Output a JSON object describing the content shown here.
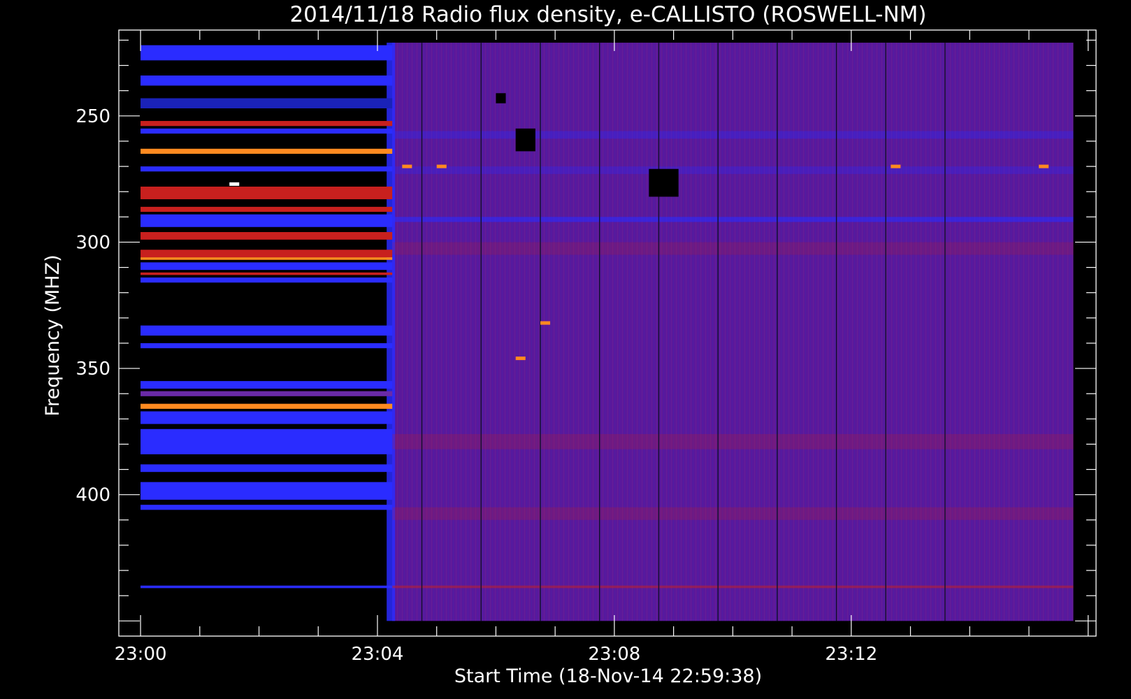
{
  "chart_data": {
    "type": "heatmap",
    "title": "2014/11/18  Radio flux density, e-CALLISTO (ROSWELL-NM)",
    "xlabel": "Start Time (18-Nov-14 22:59:38)",
    "ylabel": "Frequency (MHZ)",
    "x_unit": "HH:MM",
    "xlim": [
      "22:59:38",
      "23:16:08"
    ],
    "ylim": [
      456,
      216
    ],
    "y_inverted": true,
    "x_ticks": [
      {
        "value": "23:00",
        "label": "23:00"
      },
      {
        "value": "23:04",
        "label": "23:04"
      },
      {
        "value": "23:08",
        "label": "23:08"
      },
      {
        "value": "23:12",
        "label": "23:12"
      }
    ],
    "y_ticks": [
      {
        "value": 250,
        "label": "250"
      },
      {
        "value": 300,
        "label": "300"
      },
      {
        "value": 350,
        "label": "350"
      },
      {
        "value": 400,
        "label": "400"
      }
    ],
    "data_extent": {
      "time_start": "23:00:00",
      "time_end": "23:15:45",
      "freq_min": 221,
      "freq_max": 450
    },
    "transition_time": "23:04:15",
    "vertical_lines_time": [
      "23:04:45",
      "23:05:45",
      "23:06:45",
      "23:07:45",
      "23:08:45",
      "23:09:45",
      "23:10:45",
      "23:11:45",
      "23:12:35",
      "23:13:35"
    ],
    "pre_transition_bands": [
      {
        "freq_start": 222,
        "freq_end": 228,
        "level": "blue"
      },
      {
        "freq_start": 234,
        "freq_end": 238,
        "level": "blue"
      },
      {
        "freq_start": 243,
        "freq_end": 247,
        "level": "darkblue"
      },
      {
        "freq_start": 252,
        "freq_end": 254,
        "level": "red"
      },
      {
        "freq_start": 255,
        "freq_end": 257,
        "level": "blue"
      },
      {
        "freq_start": 263,
        "freq_end": 265,
        "level": "orange"
      },
      {
        "freq_start": 270,
        "freq_end": 272,
        "level": "blue"
      },
      {
        "freq_start": 278,
        "freq_end": 283,
        "level": "red"
      },
      {
        "freq_start": 286,
        "freq_end": 288,
        "level": "red"
      },
      {
        "freq_start": 289,
        "freq_end": 294,
        "level": "blue"
      },
      {
        "freq_start": 296,
        "freq_end": 299,
        "level": "red"
      },
      {
        "freq_start": 303,
        "freq_end": 306,
        "level": "red"
      },
      {
        "freq_start": 306,
        "freq_end": 307,
        "level": "orange"
      },
      {
        "freq_start": 308,
        "freq_end": 311,
        "level": "blue"
      },
      {
        "freq_start": 312,
        "freq_end": 313,
        "level": "red"
      },
      {
        "freq_start": 314,
        "freq_end": 316,
        "level": "blue"
      },
      {
        "freq_start": 333,
        "freq_end": 337,
        "level": "blue"
      },
      {
        "freq_start": 340,
        "freq_end": 342,
        "level": "blue"
      },
      {
        "freq_start": 355,
        "freq_end": 358,
        "level": "blue"
      },
      {
        "freq_start": 359,
        "freq_end": 361,
        "level": "purple"
      },
      {
        "freq_start": 364,
        "freq_end": 366,
        "level": "orange"
      },
      {
        "freq_start": 367,
        "freq_end": 372,
        "level": "blue"
      },
      {
        "freq_start": 374,
        "freq_end": 384,
        "level": "blue"
      },
      {
        "freq_start": 388,
        "freq_end": 391,
        "level": "blue"
      },
      {
        "freq_start": 395,
        "freq_end": 402,
        "level": "blue"
      },
      {
        "freq_start": 404,
        "freq_end": 406,
        "level": "blue"
      },
      {
        "freq_start": 436,
        "freq_end": 437,
        "level": "blue"
      }
    ],
    "hot_spots": [
      {
        "time": "23:04:30",
        "freq": 270,
        "level": "orange"
      },
      {
        "time": "23:05:05",
        "freq": 270,
        "level": "orange"
      },
      {
        "time": "23:06:50",
        "freq": 332,
        "level": "orange"
      },
      {
        "time": "23:06:25",
        "freq": 346,
        "level": "orange"
      },
      {
        "time": "23:12:45",
        "freq": 270,
        "level": "orange"
      },
      {
        "time": "23:15:15",
        "freq": 270,
        "level": "orange"
      },
      {
        "time": "23:01:35",
        "freq": 277,
        "level": "white"
      }
    ],
    "dark_blocks": [
      {
        "time_start": "23:08:35",
        "time_end": "23:09:05",
        "freq_start": 271,
        "freq_end": 282
      },
      {
        "time_start": "23:06:20",
        "time_end": "23:06:40",
        "freq_start": 255,
        "freq_end": 264
      },
      {
        "time_start": "23:06:00",
        "time_end": "23:06:10",
        "freq_start": 241,
        "freq_end": 245
      }
    ],
    "grid": false,
    "colors": {
      "background": "#000000",
      "axes": "#ffffff",
      "pre_transition": "#000000",
      "post_transition": "#5a189c",
      "blue": "#2a2cff",
      "darkblue": "#1a22b8",
      "red": "#c8201e",
      "orange": "#ff8a20",
      "purple": "#6a2aa8",
      "white": "#ffffff"
    }
  }
}
